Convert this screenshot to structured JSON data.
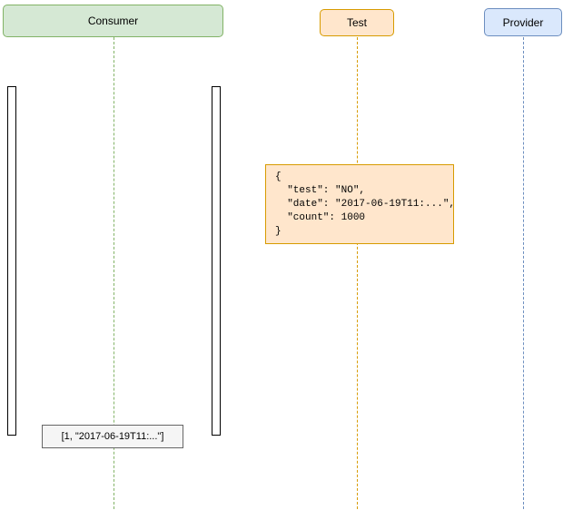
{
  "participants": {
    "consumer": "Consumer",
    "test": "Test",
    "provider": "Provider"
  },
  "note_json": {
    "line1": "{",
    "line2": "  \"test\": \"NO\",",
    "line3": "  \"date\": \"2017-06-19T11:...\",",
    "line4": "  \"count\": 1000",
    "line5": "}"
  },
  "note_array": "[1, \"2017-06-19T11:...\"]",
  "chart_data": {
    "type": "sequence-diagram",
    "participants": [
      "Consumer",
      "Test",
      "Provider"
    ],
    "notes": [
      {
        "over": "Test",
        "content_type": "json",
        "content": {
          "test": "NO",
          "date": "2017-06-19T11:...",
          "count": 1000
        }
      },
      {
        "over": "Consumer",
        "content_type": "array",
        "content": [
          1,
          "2017-06-19T11:..."
        ]
      }
    ]
  }
}
